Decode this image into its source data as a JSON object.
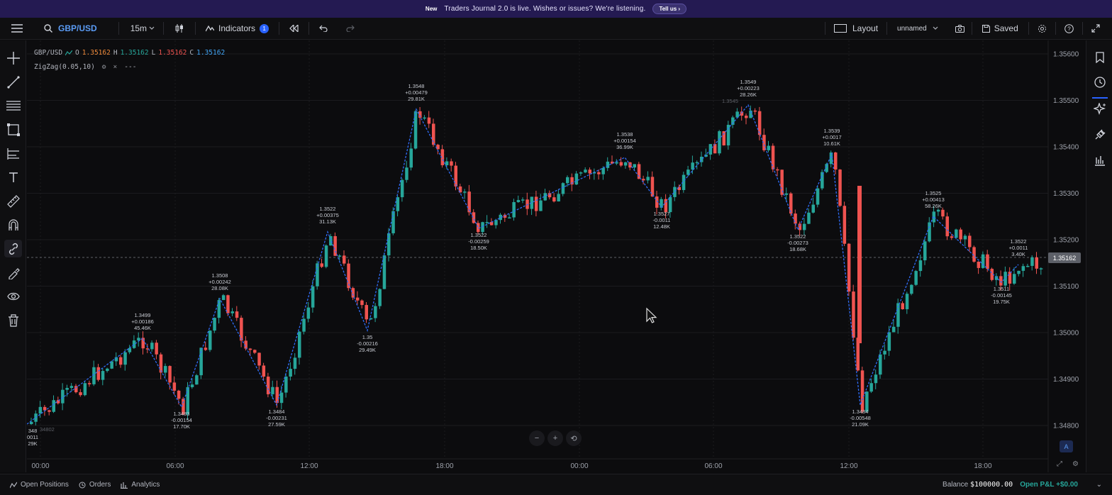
{
  "banner": {
    "new": "New",
    "message": "Traders Journal 2.0 is live. Wishes or issues? We're listening.",
    "button": "Tell us"
  },
  "toolbar": {
    "symbol": "GBP/USD",
    "interval": "15m",
    "indicators_label": "Indicators",
    "indicators_count": "1",
    "layout_label": "Layout",
    "layout_name": "unnamed",
    "saved_label": "Saved"
  },
  "legend": {
    "symbol": "GBP/USD",
    "o_label": "O",
    "o": "1.35162",
    "h_label": "H",
    "h": "1.35162",
    "l_label": "L",
    "l": "1.35162",
    "c_label": "C",
    "c": "1.35162"
  },
  "indicator": {
    "name": "ZigZag(0.05,10)",
    "value": "---"
  },
  "price_axis": {
    "ticks": [
      "1.35600",
      "1.35500",
      "1.35400",
      "1.35300",
      "1.35200",
      "1.35100",
      "1.35000",
      "1.34900",
      "1.34800"
    ],
    "current": "1.35162"
  },
  "time_axis": {
    "ticks": [
      "00:00",
      "06:00",
      "12:00",
      "18:00",
      "00:00",
      "06:00",
      "12:00",
      "18:00"
    ]
  },
  "zigzag_labels": [
    {
      "lines": [
        "348",
        "0011",
        "29K"
      ],
      "pos": "below"
    },
    {
      "lines": [
        "1.3499",
        "+0.00186",
        "45.46K"
      ],
      "pos": "above"
    },
    {
      "lines": [
        "1.3483",
        "-0.00154",
        "17.70K"
      ],
      "pos": "below"
    },
    {
      "lines": [
        "1.3508",
        "+0.00242",
        "28.08K"
      ],
      "pos": "above"
    },
    {
      "lines": [
        "1.3484",
        "-0.00231",
        "27.59K"
      ],
      "pos": "below"
    },
    {
      "lines": [
        "1.3522",
        "+0.00375",
        "31.13K"
      ],
      "pos": "above"
    },
    {
      "lines": [
        "1.35",
        "-0.00216",
        "29.49K"
      ],
      "pos": "below"
    },
    {
      "lines": [
        "1.3548",
        "+0.00479",
        "29.81K"
      ],
      "pos": "above"
    },
    {
      "lines": [
        "1.3522",
        "-0.00259",
        "18.50K"
      ],
      "pos": "below"
    },
    {
      "lines": [
        "1.3538",
        "+0.00154",
        "36.99K"
      ],
      "pos": "above"
    },
    {
      "lines": [
        "1.3527",
        "-0.0011",
        "12.48K"
      ],
      "pos": "below"
    },
    {
      "lines": [
        "1.3549",
        "+0.00223",
        "28.26K"
      ],
      "pos": "above"
    },
    {
      "lines": [
        "1.3522",
        "-0.00273",
        "18.68K"
      ],
      "pos": "below"
    },
    {
      "lines": [
        "1.3539",
        "+0.0017",
        "10.61K"
      ],
      "pos": "above"
    },
    {
      "lines": [
        "1.3484",
        "-0.00548",
        "21.09K"
      ],
      "pos": "below"
    },
    {
      "lines": [
        "1.3525",
        "+0.00413",
        "58.26K"
      ],
      "pos": "above"
    },
    {
      "lines": [
        "1.3511",
        "-0.00145",
        "19.75K"
      ],
      "pos": "below"
    },
    {
      "lines": [
        "1.3522",
        "+0.0011",
        "3.40K"
      ],
      "pos": "above"
    }
  ],
  "faint_labels": [
    "34802",
    "1.3545"
  ],
  "zoom": {
    "minus": "−",
    "plus": "+",
    "reset": "⟲"
  },
  "auto_label": "A",
  "bottom": {
    "open_positions": "Open Positions",
    "orders": "Orders",
    "analytics": "Analytics",
    "balance_label": "Balance",
    "balance_value": "$100000.00",
    "pnl_label": "Open P&L",
    "pnl_value": "+$0.00"
  },
  "colors": {
    "up": "#26a69a",
    "down": "#ef5350",
    "zigzag": "#2f6cf6",
    "accent": "#2962ff"
  }
}
